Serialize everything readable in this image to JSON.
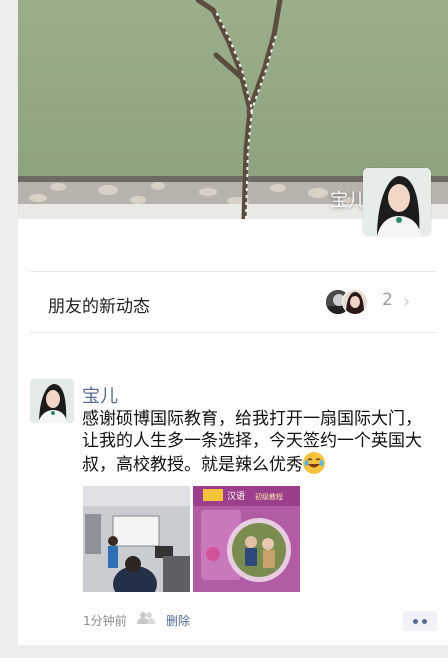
{
  "cover": {
    "user_name": "宝儿"
  },
  "notifications": {
    "label": "朋友的新动态",
    "count": "2"
  },
  "post": {
    "author": "宝儿",
    "text": "感谢硕博国际教育，给我打开一扇国际大门，让我的人生多一条选择，今天签约一个英国大叔，高校教授。就是辣么优秀",
    "emoji": "laughing-tears-emoji",
    "photos": [
      {
        "name": "classroom-photo"
      },
      {
        "name": "book-cover-photo",
        "brand_text": "汉语",
        "subtitle_text": "初级教程"
      }
    ],
    "time": "1分钟前",
    "delete_label": "删除"
  },
  "colors": {
    "link_blue": "#576b95",
    "page_bg": "#ededed",
    "cover_wall": "#93a884"
  }
}
